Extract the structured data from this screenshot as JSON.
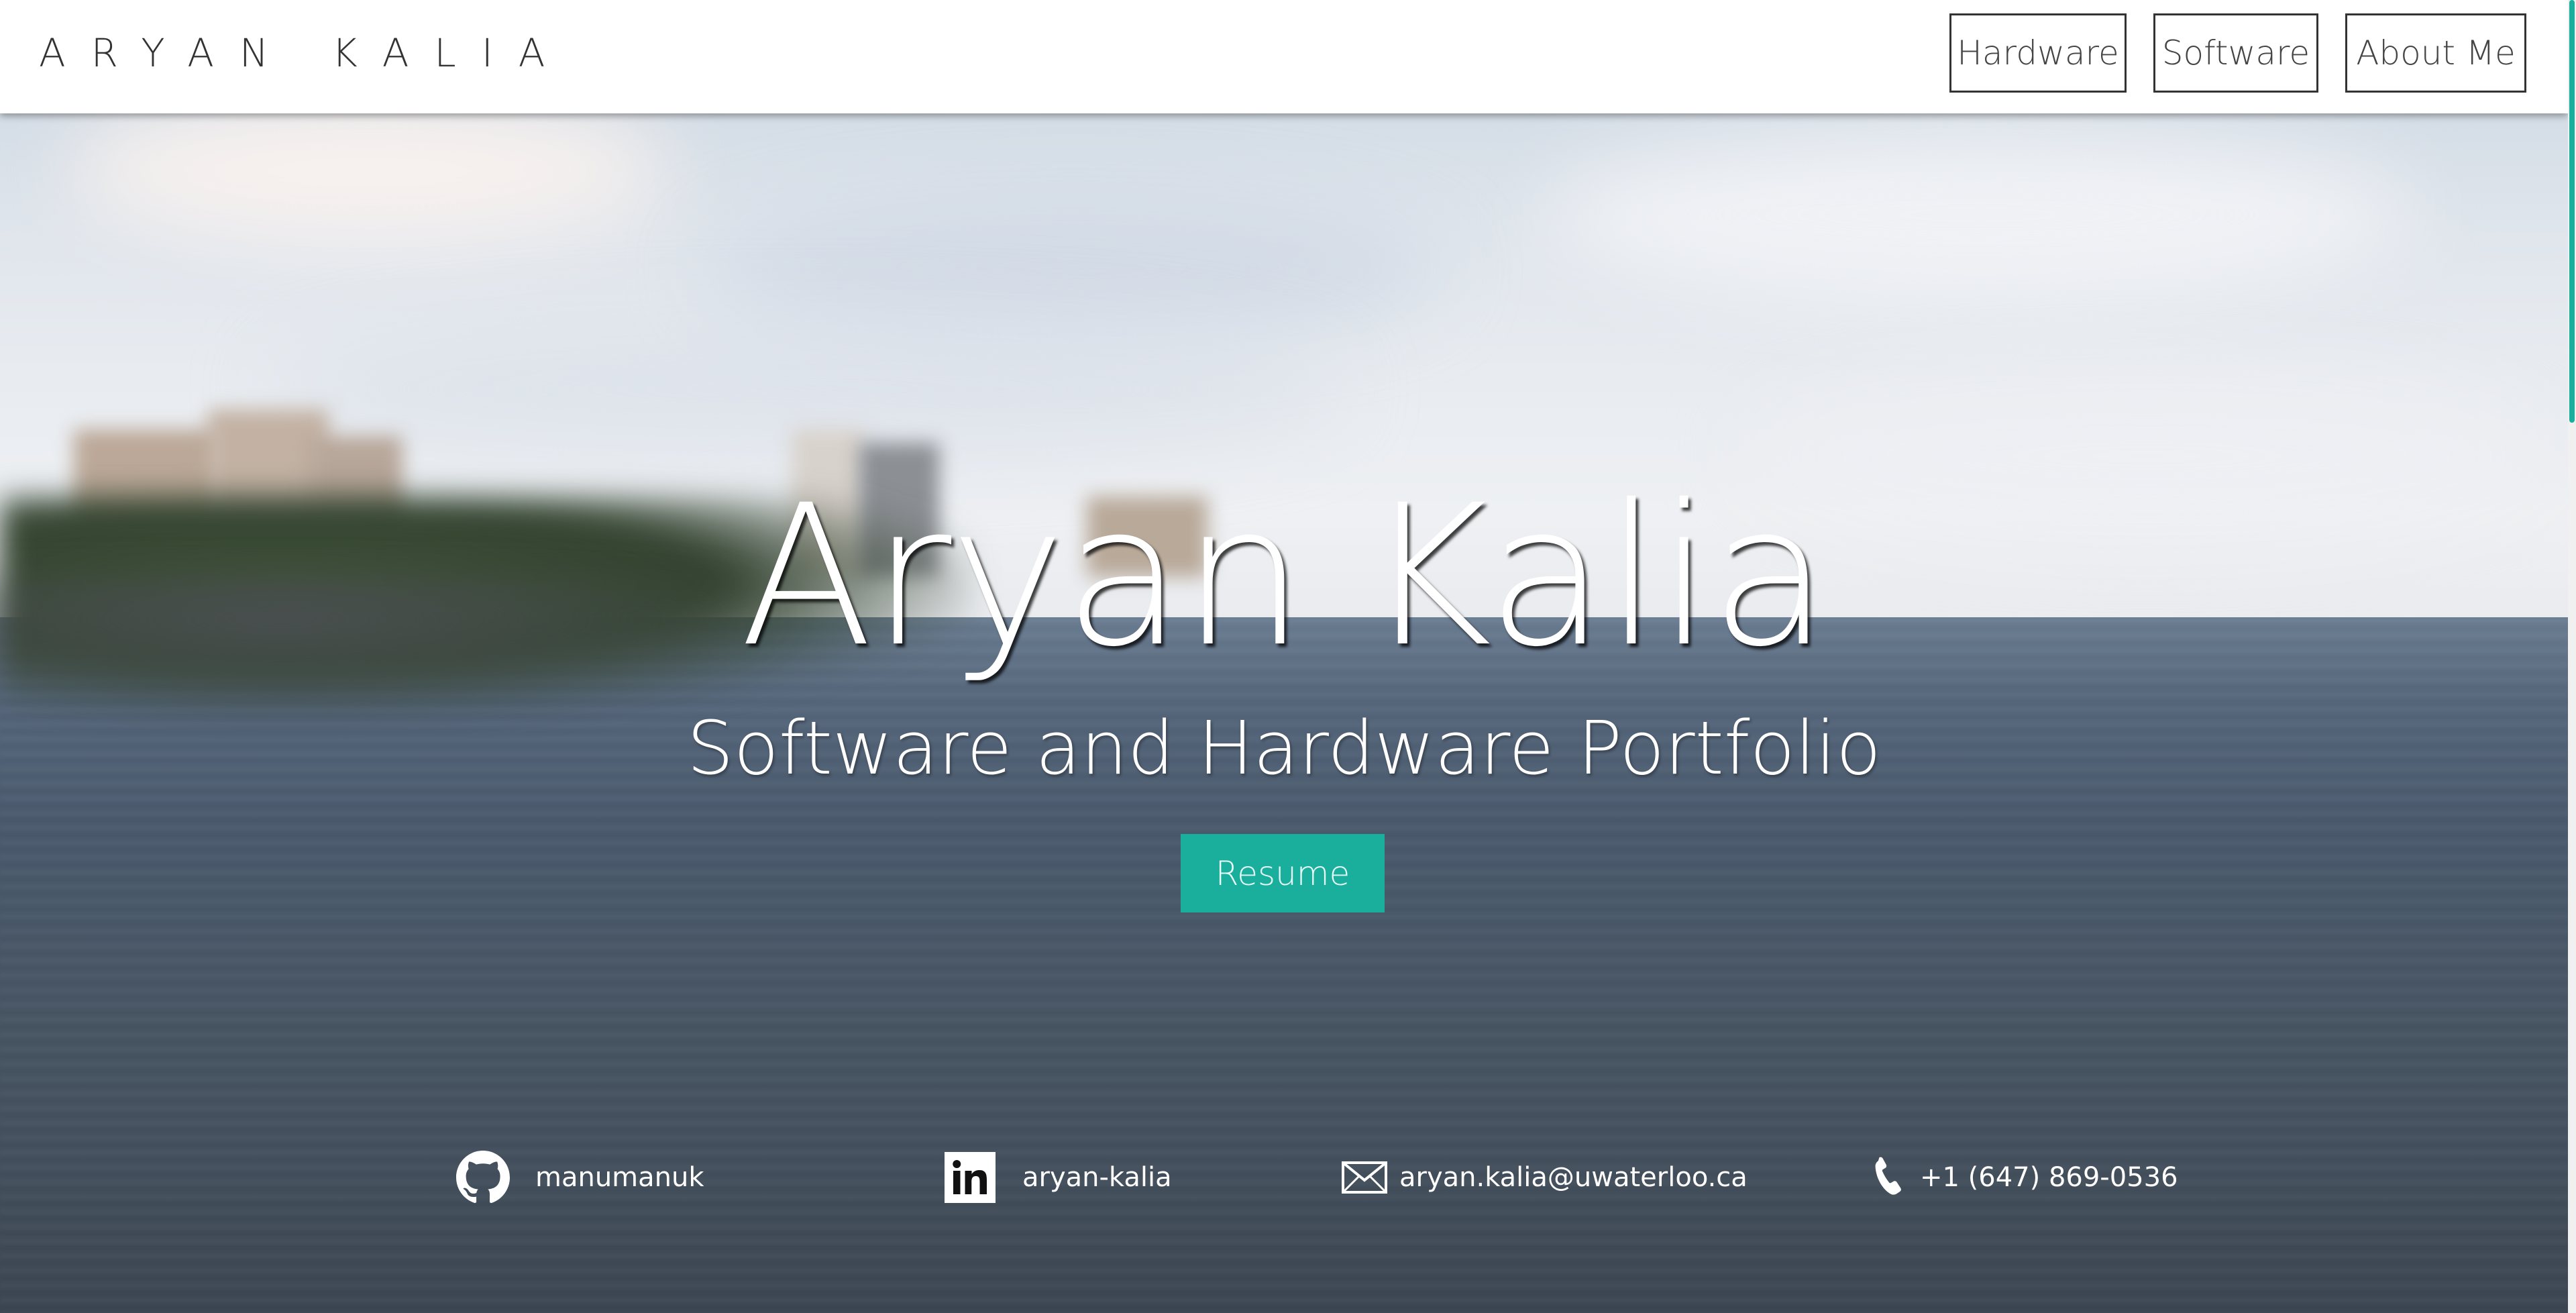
{
  "header": {
    "brand": "ARYAN KALIA",
    "nav": [
      {
        "label": "Hardware"
      },
      {
        "label": "Software"
      },
      {
        "label": "About Me"
      }
    ]
  },
  "hero": {
    "title": "Aryan Kalia",
    "subtitle": "Software and Hardware Portfolio",
    "resume_label": "Resume",
    "accent_color": "#1aaf9c"
  },
  "contacts": [
    {
      "icon": "github-icon",
      "text": "manumanuk"
    },
    {
      "icon": "linkedin-icon",
      "text": "aryan-kalia"
    },
    {
      "icon": "mail-icon",
      "text": "aryan.kalia@uwaterloo.ca"
    },
    {
      "icon": "phone-icon",
      "text": "+1 (647) 869-0536"
    }
  ]
}
